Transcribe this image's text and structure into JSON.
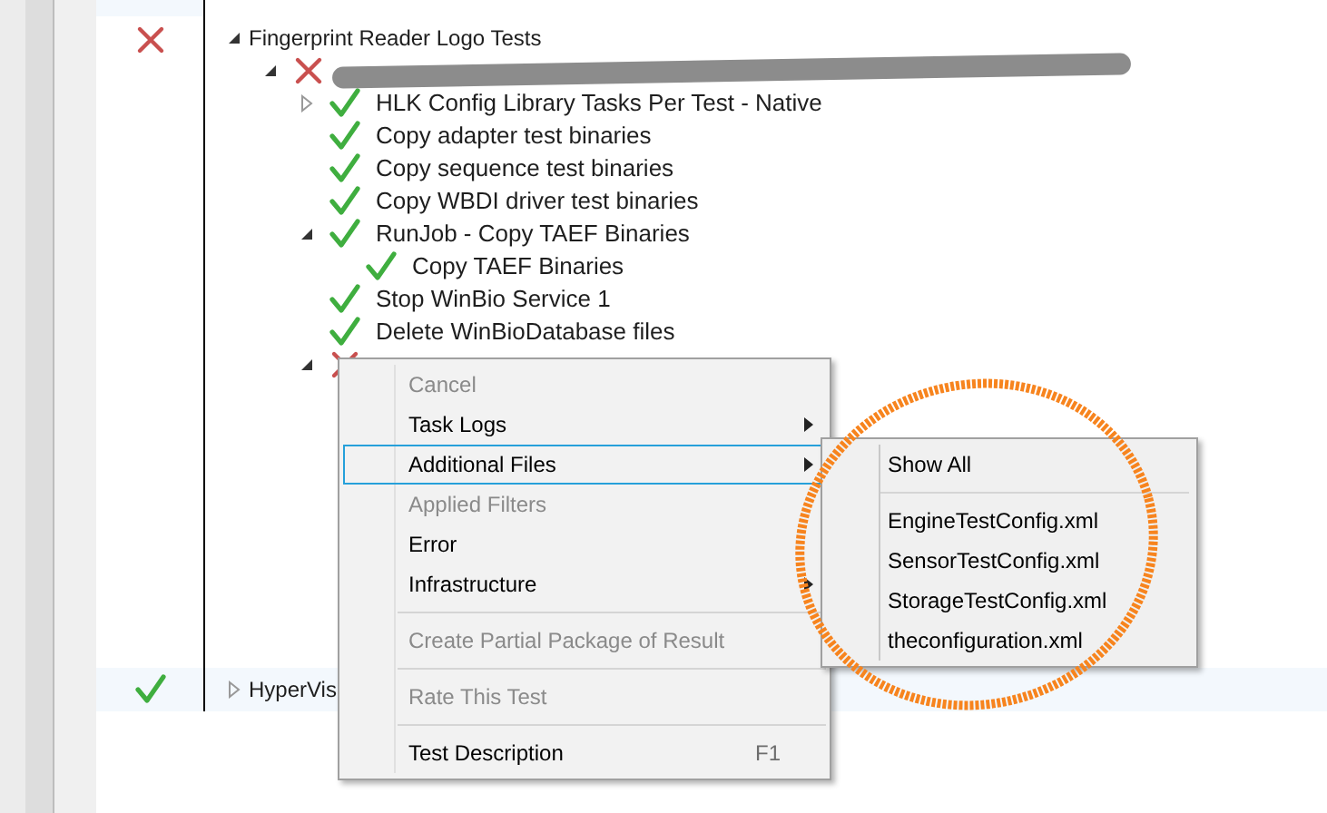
{
  "groups": [
    {
      "label": "Fingerprint Reader Logo Tests",
      "passed": false,
      "expandable": true,
      "expanded": true,
      "children": [
        {
          "kind": "redacted",
          "passed": false,
          "expandable": true,
          "expanded": true,
          "children": [
            {
              "kind": "task",
              "label": "HLK Config Library Tasks Per Test - Native",
              "passed": true,
              "expandable": true,
              "expanded": false
            },
            {
              "kind": "task",
              "label": "Copy adapter test binaries",
              "passed": true,
              "expandable": false
            },
            {
              "kind": "task",
              "label": "Copy sequence test binaries",
              "passed": true,
              "expandable": false
            },
            {
              "kind": "task",
              "label": "Copy WBDI driver test binaries",
              "passed": true,
              "expandable": false
            },
            {
              "kind": "task",
              "label": "RunJob - Copy TAEF Binaries",
              "passed": true,
              "expandable": true,
              "expanded": true,
              "children": [
                {
                  "kind": "task",
                  "label": "Copy TAEF Binaries",
                  "passed": true,
                  "expandable": false
                }
              ]
            },
            {
              "kind": "task",
              "label": "Stop WinBio Service 1",
              "passed": true,
              "expandable": false
            },
            {
              "kind": "task",
              "label": "Delete WinBioDatabase files",
              "passed": true,
              "expandable": false
            },
            {
              "kind": "covered",
              "passed": false,
              "expandable": true,
              "expanded": true
            }
          ]
        }
      ]
    },
    {
      "label": "HyperVis",
      "passed": true,
      "expandable": true,
      "expanded": false
    }
  ],
  "context_menu": [
    {
      "kind": "item",
      "label": "Cancel",
      "disabled": true,
      "selected": false,
      "submenu": false
    },
    {
      "kind": "item",
      "label": "Task Logs",
      "disabled": false,
      "selected": false,
      "submenu": true
    },
    {
      "kind": "item",
      "label": "Additional Files",
      "disabled": false,
      "selected": true,
      "submenu": true
    },
    {
      "kind": "item",
      "label": "Applied Filters",
      "disabled": true,
      "selected": false,
      "submenu": false
    },
    {
      "kind": "item",
      "label": "Error",
      "disabled": false,
      "selected": false,
      "submenu": false
    },
    {
      "kind": "item",
      "label": "Infrastructure",
      "disabled": false,
      "selected": false,
      "submenu": true
    },
    {
      "kind": "separator"
    },
    {
      "kind": "item",
      "label": "Create Partial Package of Result",
      "disabled": true,
      "selected": false,
      "submenu": false
    },
    {
      "kind": "separator"
    },
    {
      "kind": "item",
      "label": "Rate This Test",
      "disabled": true,
      "selected": false,
      "submenu": false
    },
    {
      "kind": "separator"
    },
    {
      "kind": "item",
      "label": "Test Description",
      "shortcut": "F1",
      "disabled": false,
      "selected": false,
      "submenu": false
    }
  ],
  "submenu": [
    {
      "kind": "item",
      "label": "Show All"
    },
    {
      "kind": "separator"
    },
    {
      "kind": "item",
      "label": "EngineTestConfig.xml"
    },
    {
      "kind": "item",
      "label": "SensorTestConfig.xml"
    },
    {
      "kind": "item",
      "label": "StorageTestConfig.xml"
    },
    {
      "kind": "item",
      "label": "theconfiguration.xml"
    }
  ]
}
